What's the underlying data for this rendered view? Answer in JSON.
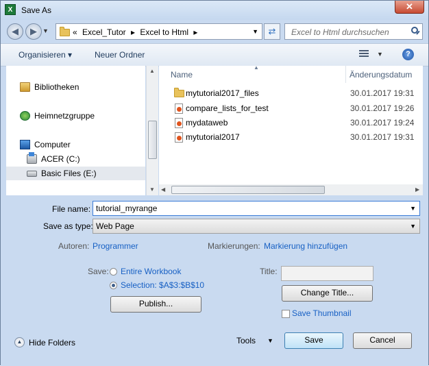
{
  "window": {
    "title": "Save As",
    "close_glyph": "✕"
  },
  "address_bar": {
    "overflow": "«",
    "crumbs": [
      "Excel_Tutor",
      "Excel to Html"
    ],
    "separator": "▸"
  },
  "search": {
    "placeholder": "Excel to Html durchsuchen"
  },
  "toolbar": {
    "organize_label": "Organisieren ▾",
    "new_folder_label": "Neuer Ordner"
  },
  "nav_pane": {
    "items": [
      {
        "label": "Bibliotheken",
        "icon": "library-icon"
      },
      {
        "label": "Heimnetzgruppe",
        "icon": "homegroup-icon"
      },
      {
        "label": "Computer",
        "icon": "computer-icon"
      },
      {
        "label": "ACER (C:)",
        "icon": "os-drive-icon"
      },
      {
        "label": "Basic Files (E:)",
        "icon": "drive-icon",
        "selected": true
      }
    ]
  },
  "file_list": {
    "columns": [
      "Name",
      "Änderungsdatum"
    ],
    "rows": [
      {
        "name": "mytutorial2017_files",
        "date": "30.01.2017 19:31",
        "icon": "folder-icon"
      },
      {
        "name": "compare_lists_for_test",
        "date": "30.01.2017 19:26",
        "icon": "html-file-icon"
      },
      {
        "name": "mydataweb",
        "date": "30.01.2017 19:24",
        "icon": "html-file-icon"
      },
      {
        "name": "mytutorial2017",
        "date": "30.01.2017 19:31",
        "icon": "html-file-icon"
      }
    ]
  },
  "form": {
    "file_name_label": "File name:",
    "file_name_value": "tutorial_myrange",
    "save_as_type_label": "Save as type:",
    "save_as_type_value": "Web Page",
    "authors_label": "Autoren:",
    "authors_value": "Programmer",
    "tags_label": "Markierungen:",
    "tags_value": "Markierung hinzufügen",
    "save_label": "Save:",
    "option_workbook": "Entire Workbook",
    "option_selection": "Selection: $A$3:$B$10",
    "selected_option": "selection",
    "publish_label": "Publish...",
    "title_label": "Title:",
    "title_value": "",
    "change_title_label": "Change Title...",
    "save_thumbnail_label": "Save Thumbnail",
    "save_thumbnail_checked": false
  },
  "footer": {
    "hide_folders_label": "Hide Folders",
    "tools_label": "Tools",
    "save_button": "Save",
    "cancel_button": "Cancel"
  },
  "colors": {
    "link": "#1760c4",
    "dialog_bg": "#c9daf0"
  }
}
